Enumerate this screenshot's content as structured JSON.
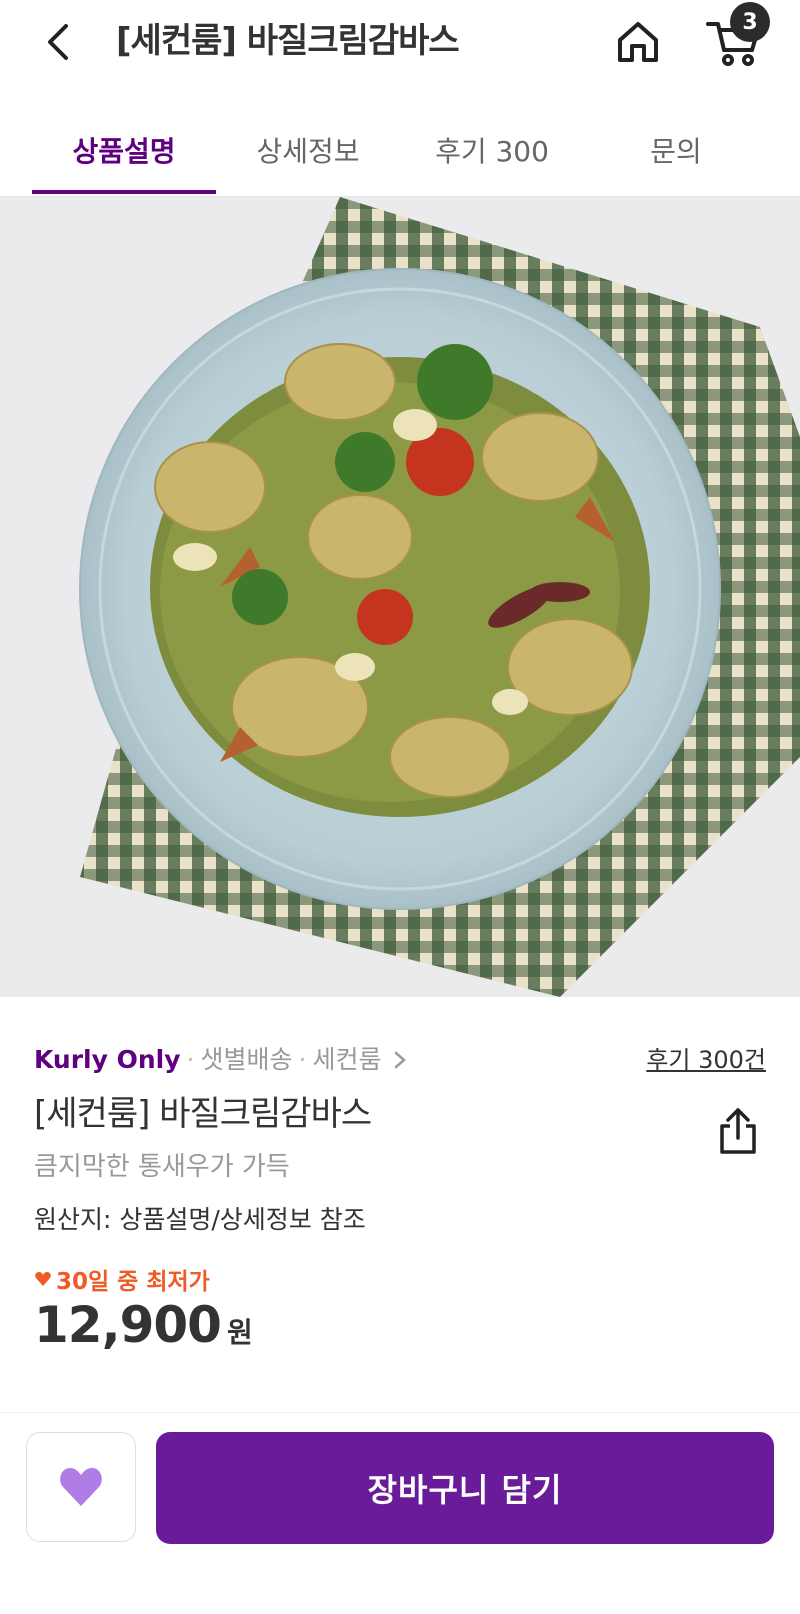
{
  "header": {
    "title": "[세컨룸] 바질크림감바스",
    "cart_count": "3",
    "icons": [
      "chevron-left-icon",
      "home-icon",
      "cart-icon"
    ]
  },
  "tabs": [
    {
      "label": "상품설명",
      "active": true
    },
    {
      "label": "상세정보",
      "active": false
    },
    {
      "label": "후기 300",
      "active": false
    },
    {
      "label": "문의",
      "active": false
    }
  ],
  "product": {
    "brand": "Kurly Only",
    "delivery": "샛별배송",
    "seller": "세컨룸",
    "review_link": "후기 300건",
    "name": "[세컨룸] 바질크림감바스",
    "subtitle": "큼지막한 통새우가 가득",
    "origin": "원산지: 상품설명/상세정보 참조",
    "lowest_label": "30일 중 최저가",
    "price": "12,900",
    "price_unit": "원"
  },
  "bottom": {
    "add_to_cart": "장바구니 담기"
  },
  "colors": {
    "accent": "#5f0080",
    "button": "#6a1b9a",
    "lowest": "#f05a24",
    "wish_heart": "#b07ce6"
  }
}
